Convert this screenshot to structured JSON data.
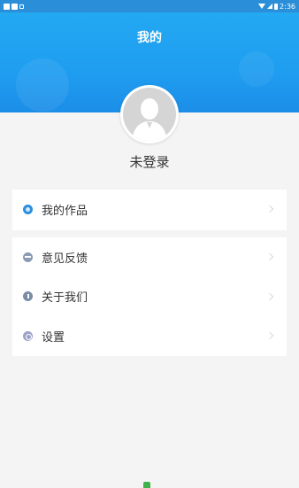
{
  "status_bar": {
    "time": "2:36"
  },
  "header": {
    "title": "我的"
  },
  "profile": {
    "login_status": "未登录"
  },
  "menu": {
    "group1": [
      {
        "label": "我的作品",
        "icon": "works-icon"
      }
    ],
    "group2": [
      {
        "label": "意见反馈",
        "icon": "feedback-icon"
      },
      {
        "label": "关于我们",
        "icon": "about-icon"
      },
      {
        "label": "设置",
        "icon": "settings-icon"
      }
    ]
  },
  "colors": {
    "header_blue": "#1f9df0",
    "background": "#f4f4f4"
  }
}
